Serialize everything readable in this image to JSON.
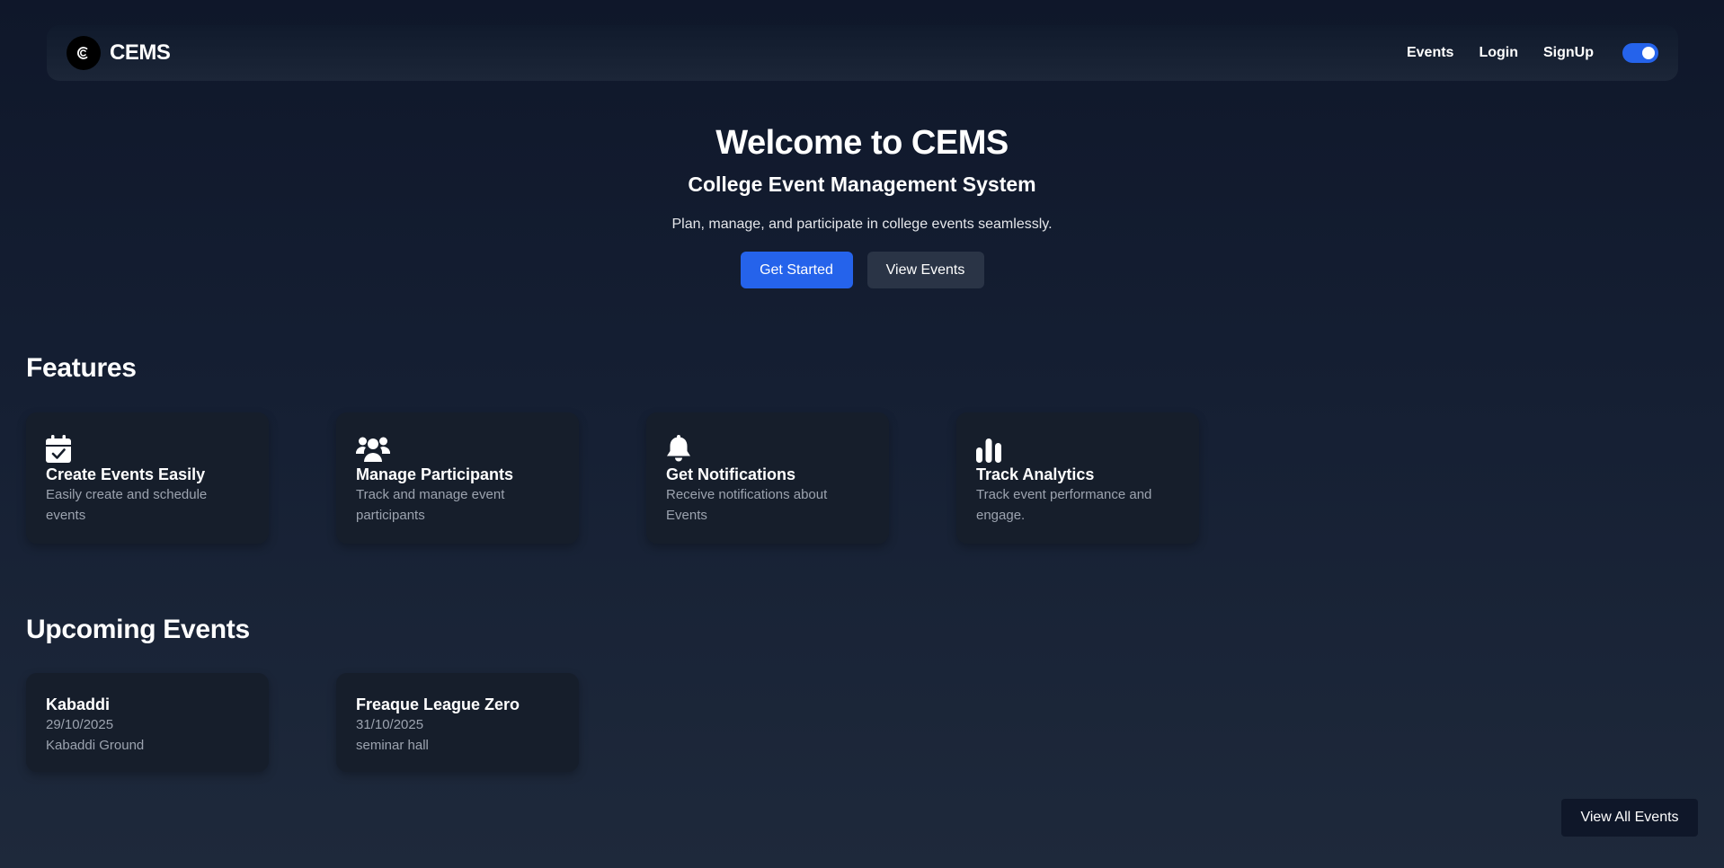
{
  "nav": {
    "brand": "CEMS",
    "links": [
      "Events",
      "Login",
      "SignUp"
    ],
    "theme_toggle_on": true,
    "accent": "#2563eb"
  },
  "hero": {
    "title": "Welcome to CEMS",
    "subtitle": "College Event Management System",
    "description": "Plan, manage, and participate in college events seamlessly.",
    "primary_button": "Get Started",
    "secondary_button": "View Events"
  },
  "features": {
    "heading": "Features",
    "items": [
      {
        "icon": "calendar-check-icon",
        "title": "Create Events Easily",
        "description": "Easily create and schedule events"
      },
      {
        "icon": "users-icon",
        "title": "Manage Participants",
        "description": "Track and manage event participants"
      },
      {
        "icon": "bell-icon",
        "title": "Get Notifications",
        "description": "Receive notifications about Events"
      },
      {
        "icon": "bar-chart-icon",
        "title": "Track Analytics",
        "description": "Track event performance and engage."
      }
    ]
  },
  "upcoming": {
    "heading": "Upcoming Events",
    "events": [
      {
        "name": "Kabaddi",
        "date": "29/10/2025",
        "venue": "Kabaddi Ground"
      },
      {
        "name": "Freaque League Zero",
        "date": "31/10/2025",
        "venue": "seminar hall"
      }
    ],
    "view_all_label": "View All Events"
  }
}
